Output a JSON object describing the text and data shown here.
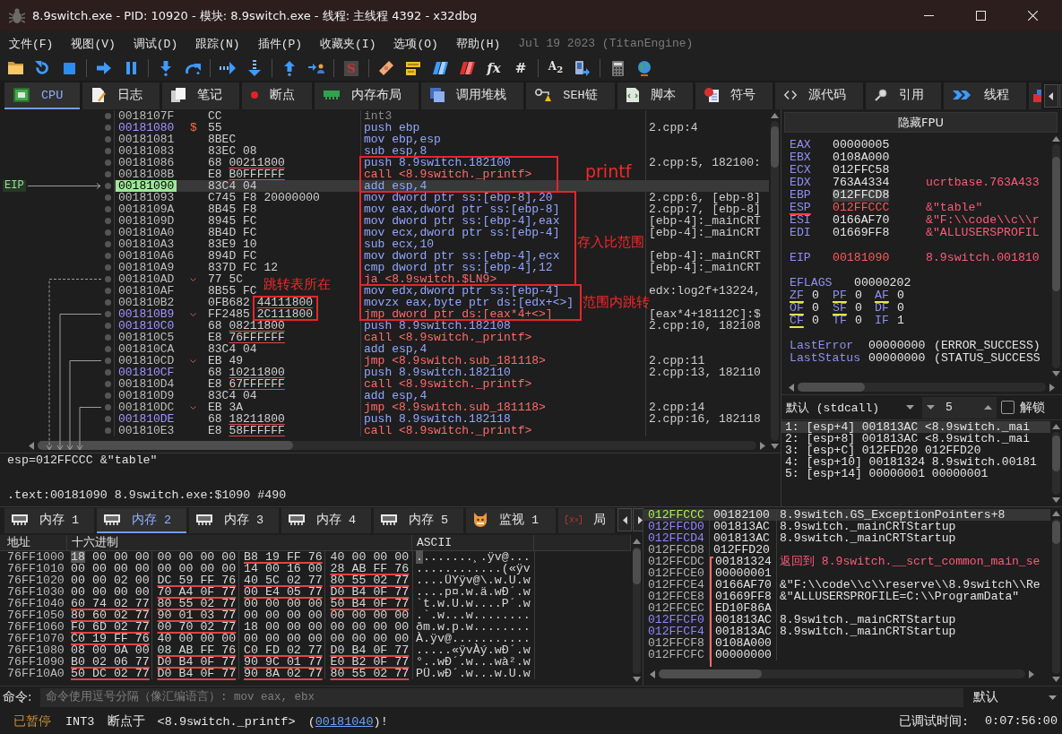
{
  "window": {
    "title": "8.9switch.exe - PID: 10920 - 模块: 8.9switch.exe - 线程: 主线程 4392 - x32dbg"
  },
  "menu": {
    "items": [
      "文件(F)",
      "视图(V)",
      "调试(D)",
      "跟踪(N)",
      "插件(P)",
      "收藏夹(I)",
      "选项(O)",
      "帮助(H)"
    ],
    "build_info": "Jul 19 2023 (TitanEngine)"
  },
  "toolbar": {
    "script_glyph": "S",
    "function_glyph": "fx",
    "hash_glyph": "#",
    "font_glyph": "A$_{2}$"
  },
  "tabs": [
    {
      "label": "CPU",
      "selected": true
    },
    {
      "label": "日志",
      "selected": false
    },
    {
      "label": "笔记",
      "selected": false
    },
    {
      "label": "断点",
      "selected": false
    },
    {
      "label": "内存布局",
      "selected": false
    },
    {
      "label": "调用堆栈",
      "selected": false
    },
    {
      "label": "SEH链",
      "selected": false
    },
    {
      "label": "脚本",
      "selected": false
    },
    {
      "label": "符号",
      "selected": false
    },
    {
      "label": "源代码",
      "selected": false
    },
    {
      "label": "引用",
      "selected": false
    },
    {
      "label": "线程",
      "selected": false
    }
  ],
  "disassembly": {
    "eip_label": "EIP",
    "rows": [
      {
        "address": "0018107F",
        "bytes": "CC",
        "instruction": "int3",
        "kind": "int3",
        "target": false,
        "current": false
      },
      {
        "address": "00181080",
        "marker": "$",
        "bytes": "55",
        "instruction": "push ebp",
        "comment": "2.cpp:4",
        "kind": "other",
        "target": true,
        "current": false
      },
      {
        "address": "00181081",
        "bytes": "8BEC",
        "instruction": "mov ebp,esp",
        "kind": "other",
        "target": false,
        "current": false
      },
      {
        "address": "00181083",
        "bytes": "83EC 08",
        "instruction": "sub esp,8",
        "kind": "other",
        "target": false,
        "current": false
      },
      {
        "address": "00181086",
        "bytes": "68",
        "operand": "00211800",
        "instruction": "push 8.9switch.182100",
        "comment": "2.cpp:5, 182100:",
        "kind": "other",
        "target": false,
        "current": false
      },
      {
        "address": "0018108B",
        "bytes": "E8",
        "operand": "B0FFFFFF",
        "instruction": "call <8.9switch._printf>",
        "kind": "call",
        "target": false,
        "current": false
      },
      {
        "address": "00181090",
        "bytes": "83C4 04",
        "instruction": "add esp,4",
        "kind": "other",
        "target": false,
        "current": true
      },
      {
        "address": "00181093",
        "bytes": "C745 F8 20000000",
        "instruction": "mov dword ptr ss:[ebp-8],20",
        "comment": "2.cpp:6, [ebp-8]",
        "kind": "other",
        "target": false,
        "current": false
      },
      {
        "address": "0018109A",
        "bytes": "8B45 F8",
        "instruction": "mov eax,dword ptr ss:[ebp-8]",
        "comment": "2.cpp:7, [ebp-8]",
        "kind": "other",
        "target": false,
        "current": false
      },
      {
        "address": "0018109D",
        "bytes": "8945 FC",
        "instruction": "mov dword ptr ss:[ebp-4],eax",
        "comment": "[ebp-4]:_mainCRT",
        "kind": "other",
        "target": false,
        "current": false
      },
      {
        "address": "001810A0",
        "bytes": "8B4D FC",
        "instruction": "mov ecx,dword ptr ss:[ebp-4]",
        "comment": "[ebp-4]:_mainCRT",
        "kind": "other",
        "target": false,
        "current": false
      },
      {
        "address": "001810A3",
        "bytes": "83E9 10",
        "instruction": "sub ecx,10",
        "kind": "other",
        "target": false,
        "current": false
      },
      {
        "address": "001810A6",
        "bytes": "894D FC",
        "instruction": "mov dword ptr ss:[ebp-4],ecx",
        "comment": "[ebp-4]:_mainCRT",
        "kind": "other",
        "target": false,
        "current": false
      },
      {
        "address": "001810A9",
        "bytes": "837D FC 12",
        "instruction": "cmp dword ptr ss:[ebp-4],12",
        "comment": "[ebp-4]:_mainCRT",
        "kind": "other",
        "target": false,
        "current": false
      },
      {
        "address": "001810AD",
        "bytes": "77 5C",
        "instruction": "ja <8.9switch.$LN9>",
        "kind": "branch",
        "target": false,
        "current": false
      },
      {
        "address": "001810AF",
        "bytes": "8B55 FC",
        "instruction": "mov edx,dword ptr ss:[ebp-4]",
        "comment": "edx:log2f+13224,",
        "kind": "other",
        "target": false,
        "current": false
      },
      {
        "address": "001810B2",
        "bytes": "0FB682",
        "operand": "44111800",
        "instruction": "movzx eax,byte ptr ds:[edx+<>]",
        "kind": "other",
        "target": false,
        "current": false
      },
      {
        "address": "001810B9",
        "bytes": "FF2485",
        "operand": "2C111800",
        "instruction": "jmp dword ptr ds:[eax*4+<>]",
        "comment": "[eax*4+18112C]:$",
        "kind": "jump",
        "target": true,
        "current": false
      },
      {
        "address": "001810C0",
        "bytes": "68",
        "operand": "08211800",
        "instruction": "push 8.9switch.182108",
        "comment": "2.cpp:10, 182108",
        "kind": "other",
        "target": true,
        "current": false
      },
      {
        "address": "001810C5",
        "bytes": "E8",
        "operand": "76FFFFFF",
        "instruction": "call <8.9switch._printf>",
        "kind": "call",
        "target": false,
        "current": false
      },
      {
        "address": "001810CA",
        "bytes": "83C4 04",
        "instruction": "add esp,4",
        "kind": "other",
        "target": false,
        "current": false
      },
      {
        "address": "001810CD",
        "bytes": "EB 49",
        "instruction": "jmp <8.9switch.sub_181118>",
        "comment": "2.cpp:11",
        "kind": "jump",
        "target": false,
        "current": false
      },
      {
        "address": "001810CF",
        "bytes": "68",
        "operand": "10211800",
        "instruction": "push 8.9switch.182110",
        "comment": "2.cpp:13, 182110",
        "kind": "other",
        "target": true,
        "current": false
      },
      {
        "address": "001810D4",
        "bytes": "E8",
        "operand": "67FFFFFF",
        "instruction": "call <8.9switch._printf>",
        "kind": "call",
        "target": false,
        "current": false
      },
      {
        "address": "001810D9",
        "bytes": "83C4 04",
        "instruction": "add esp,4",
        "kind": "other",
        "target": false,
        "current": false
      },
      {
        "address": "001810DC",
        "bytes": "EB 3A",
        "instruction": "jmp <8.9switch.sub_181118>",
        "comment": "2.cpp:14",
        "kind": "jump",
        "target": false,
        "current": false
      },
      {
        "address": "001810DE",
        "bytes": "68",
        "operand": "18211800",
        "instruction": "push 8.9switch.182118",
        "comment": "2.cpp:16, 182118",
        "kind": "other",
        "target": true,
        "current": false
      },
      {
        "address": "001810E3",
        "bytes": "E8",
        "operand": "58FFFFFF",
        "instruction": "call <8.9switch._printf>",
        "kind": "call",
        "target": false,
        "current": false
      }
    ],
    "notes": [
      "printf",
      "存入比范围",
      "跳转表所在",
      "范围内跳转"
    ]
  },
  "registers": {
    "fpu_button": "隐藏FPU",
    "general": [
      {
        "name": "EAX",
        "value": "00000005",
        "changed": false,
        "selected": false,
        "underlined": false
      },
      {
        "name": "EBX",
        "value": "0108A000",
        "changed": false,
        "selected": false,
        "underlined": false
      },
      {
        "name": "ECX",
        "value": "012FFC58",
        "changed": false,
        "selected": false,
        "underlined": false
      },
      {
        "name": "EDX",
        "value": "763A4334",
        "comment": "ucrtbase.763A433",
        "changed": false,
        "selected": false,
        "underlined": false
      },
      {
        "name": "EBP",
        "value": "012FFCD8",
        "changed": false,
        "selected": true,
        "underlined": false
      },
      {
        "name": "ESP",
        "value": "012FFCCC",
        "comment": "&\"table\"",
        "changed": true,
        "selected": false,
        "underlined": true
      },
      {
        "name": "ESI",
        "value": "0166AF70",
        "comment": "&\"F:\\\\code\\\\c\\\\r",
        "changed": false,
        "selected": false,
        "underlined": false
      },
      {
        "name": "EDI",
        "value": "01669FF8",
        "comment": "&\"ALLUSERSPROFIL",
        "changed": false,
        "selected": false,
        "underlined": false
      }
    ],
    "eip": {
      "name": "EIP",
      "value": "00181090",
      "comment": "8.9switch.001810",
      "changed": true,
      "selected": false,
      "underlined": false
    },
    "eflags": {
      "name": "EFLAGS",
      "value": "00000202"
    },
    "flags": [
      {
        "name": "ZF",
        "value": "0",
        "underlined": true
      },
      {
        "name": "PF",
        "value": "0",
        "underlined": true
      },
      {
        "name": "AF",
        "value": "0",
        "underlined": true
      },
      {
        "name": "OF",
        "value": "0",
        "underlined": true
      },
      {
        "name": "SF",
        "value": "0",
        "underlined": true
      },
      {
        "name": "DF",
        "value": "0",
        "underlined": false
      },
      {
        "name": "CF",
        "value": "0",
        "underlined": true
      },
      {
        "name": "TF",
        "value": "0",
        "underlined": false
      },
      {
        "name": "IF",
        "value": "1",
        "underlined": false
      }
    ],
    "last": [
      {
        "name": "LastError",
        "value": "00000000",
        "comment": "(ERROR_SUCCESS)"
      },
      {
        "name": "LastStatus",
        "value": "00000000",
        "comment": "(STATUS_SUCCESS"
      }
    ]
  },
  "call_args": {
    "convention": "默认 (stdcall)",
    "count": "5",
    "unlock": {
      "label": "解锁",
      "checked": false
    },
    "rows": [
      {
        "text": "1: [esp+4] 001813AC <8.9switch._mai",
        "selected": true
      },
      {
        "text": "2: [esp+8] 001813AC <8.9switch._mai",
        "selected": false
      },
      {
        "text": "3: [esp+C] 012FFD20 012FFD20",
        "selected": false
      },
      {
        "text": "4: [esp+10] 00181324 8.9switch.00181",
        "selected": false
      },
      {
        "text": "5: [esp+14] 00000001 00000001",
        "selected": false
      }
    ]
  },
  "info": {
    "lines": [
      "esp=012FFCCC &\"table\"",
      ".text:00181090 8.9switch.exe:$1090 #490"
    ]
  },
  "memory": {
    "tabs": [
      {
        "label": "内存 1",
        "selected": false
      },
      {
        "label": "内存 2",
        "selected": true
      },
      {
        "label": "内存 3",
        "selected": false
      },
      {
        "label": "内存 4",
        "selected": false
      },
      {
        "label": "内存 5",
        "selected": false
      },
      {
        "label": "监视 1",
        "selected": false
      },
      {
        "label": "局",
        "selected": false
      }
    ],
    "columns": [
      "地址",
      "十六进制",
      "ASCII"
    ],
    "rows": [
      {
        "address": "76FF1000",
        "groups": [
          {
            "hex": "18 00 00 00",
            "pointer": false
          },
          {
            "hex": "00 00 00 00",
            "pointer": false
          },
          {
            "hex": "B8 19 FF 76",
            "pointer": true
          },
          {
            "hex": "40 00 00 00",
            "pointer": false
          }
        ],
        "ascii": "........¸.ÿv@...",
        "selected": true
      },
      {
        "address": "76FF1010",
        "groups": [
          {
            "hex": "00 00 00 00",
            "pointer": false
          },
          {
            "hex": "00 00 00 00",
            "pointer": false
          },
          {
            "hex": "14 00 16 00",
            "pointer": false
          },
          {
            "hex": "28 AB FF 76",
            "pointer": true
          }
        ],
        "ascii": "............(«ÿv",
        "selected": false
      },
      {
        "address": "76FF1020",
        "groups": [
          {
            "hex": "00 00 02 00",
            "pointer": false
          },
          {
            "hex": "DC 59 FF 76",
            "pointer": true
          },
          {
            "hex": "40 5C 02 77",
            "pointer": true
          },
          {
            "hex": "80 55 02 77",
            "pointer": true
          }
        ],
        "ascii": "....ÜYÿv@\\.w.U.w",
        "selected": false
      },
      {
        "address": "76FF1030",
        "groups": [
          {
            "hex": "00 00 00 00",
            "pointer": false
          },
          {
            "hex": "70 A4 0F 77",
            "pointer": true
          },
          {
            "hex": "00 E4 05 77",
            "pointer": true
          },
          {
            "hex": "D0 B4 0F 77",
            "pointer": true
          }
        ],
        "ascii": "....p¤.w.ä.wÐ´.w",
        "selected": false
      },
      {
        "address": "76FF1040",
        "groups": [
          {
            "hex": "60 74 02 77",
            "pointer": true
          },
          {
            "hex": "80 55 02 77",
            "pointer": true
          },
          {
            "hex": "00 00 00 00",
            "pointer": false
          },
          {
            "hex": "50 B4 0F 77",
            "pointer": true
          }
        ],
        "ascii": "`t.w.U.w....P´.w",
        "selected": false
      },
      {
        "address": "76FF1050",
        "groups": [
          {
            "hex": "80 60 02 77",
            "pointer": true
          },
          {
            "hex": "90 01 03 77",
            "pointer": true
          },
          {
            "hex": "00 00 00 00",
            "pointer": false
          },
          {
            "hex": "00 00 00 00",
            "pointer": false
          }
        ],
        "ascii": ".`.w...w........",
        "selected": false
      },
      {
        "address": "76FF1060",
        "groups": [
          {
            "hex": "F0 6D 02 77",
            "pointer": true
          },
          {
            "hex": "00 70 02 77",
            "pointer": true
          },
          {
            "hex": "18 00 00 00",
            "pointer": false
          },
          {
            "hex": "00 00 00 00",
            "pointer": false
          }
        ],
        "ascii": "ðm.w.p.w........",
        "selected": false
      },
      {
        "address": "76FF1070",
        "groups": [
          {
            "hex": "C0 19 FF 76",
            "pointer": true
          },
          {
            "hex": "40 00 00 00",
            "pointer": false
          },
          {
            "hex": "00 00 00 00",
            "pointer": false
          },
          {
            "hex": "00 00 00 00",
            "pointer": false
          }
        ],
        "ascii": "À.ÿv@...........",
        "selected": false
      },
      {
        "address": "76FF1080",
        "groups": [
          {
            "hex": "08 00 0A 00",
            "pointer": false
          },
          {
            "hex": "08 AB FF 76",
            "pointer": true
          },
          {
            "hex": "C0 FD 02 77",
            "pointer": true
          },
          {
            "hex": "D0 B4 0F 77",
            "pointer": true
          }
        ],
        "ascii": ".....«ÿvÀý.wÐ´.w",
        "selected": false
      },
      {
        "address": "76FF1090",
        "groups": [
          {
            "hex": "B0 02 06 77",
            "pointer": true
          },
          {
            "hex": "D0 B4 0F 77",
            "pointer": true
          },
          {
            "hex": "90 9C 01 77",
            "pointer": true
          },
          {
            "hex": "E0 B2 0F 77",
            "pointer": true
          }
        ],
        "ascii": "°..wÐ´.w...wà².w",
        "selected": false
      },
      {
        "address": "76FF10A0",
        "groups": [
          {
            "hex": "50 DC 02 77",
            "pointer": true
          },
          {
            "hex": "D0 B4 0F 77",
            "pointer": true
          },
          {
            "hex": "90 8A 02 77",
            "pointer": true
          },
          {
            "hex": "80 55 02 77",
            "pointer": true
          }
        ],
        "ascii": "PÜ.wÐ´.w...w.U.w",
        "selected": false
      }
    ]
  },
  "stack": {
    "rows": [
      {
        "address": "012FFCCC",
        "value": "00182100",
        "comment": "8.9switch.GS_ExceptionPointers+8",
        "kind": "esp",
        "selected": true
      },
      {
        "address": "012FFCD0",
        "value": "001813AC",
        "comment": "8.9switch._mainCRTStartup",
        "kind": "code",
        "selected": false
      },
      {
        "address": "012FFCD4",
        "value": "001813AC",
        "comment": "8.9switch._mainCRTStartup",
        "kind": "code",
        "selected": false
      },
      {
        "address": "012FFCD8",
        "value": "012FFD20",
        "kind": "data",
        "selected": false
      },
      {
        "address": "012FFCDC",
        "value": "00181324",
        "comment": "返回到 8.9switch.__scrt_common_main_se",
        "kind": "return",
        "selected": false
      },
      {
        "address": "012FFCE0",
        "value": "00000001",
        "kind": "data",
        "selected": false
      },
      {
        "address": "012FFCE4",
        "value": "0166AF70",
        "comment": "&\"F:\\\\code\\\\c\\\\reserve\\\\8.9switch\\\\Re",
        "kind": "data",
        "selected": false
      },
      {
        "address": "012FFCE8",
        "value": "01669FF8",
        "comment": "&\"ALLUSERSPROFILE=C:\\\\ProgramData\"",
        "kind": "data",
        "selected": false
      },
      {
        "address": "012FFCEC",
        "value": "ED10F86A",
        "kind": "data",
        "selected": false
      },
      {
        "address": "012FFCF0",
        "value": "001813AC",
        "comment": "8.9switch._mainCRTStartup",
        "kind": "code",
        "selected": false
      },
      {
        "address": "012FFCF4",
        "value": "001813AC",
        "comment": "8.9switch._mainCRTStartup",
        "kind": "code",
        "selected": false
      },
      {
        "address": "012FFCF8",
        "value": "0108A000",
        "kind": "data",
        "selected": false
      },
      {
        "address": "012FFCFC",
        "value": "00000000",
        "kind": "data",
        "selected": false
      }
    ]
  },
  "command": {
    "label": "命令:",
    "placeholder": "命令使用逗号分隔（像汇编语言）: mov eax, ebx",
    "mode": "默认"
  },
  "status_bar": {
    "state": "已暂停",
    "message": "INT3 断点于 <8.9switch._printf> (",
    "link": "00181040",
    "message_end": ")!",
    "time_label": "已调试时间:",
    "time": "0:07:56:00"
  }
}
